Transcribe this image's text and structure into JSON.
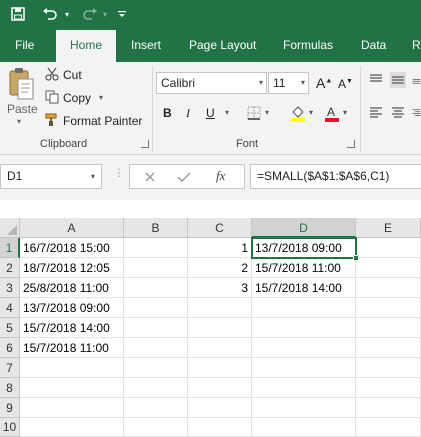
{
  "ribbon_tabs": [
    "File",
    "Home",
    "Insert",
    "Page Layout",
    "Formulas",
    "Data",
    "R"
  ],
  "active_tab": "Home",
  "clipboard": {
    "paste_label": "Paste",
    "cut_label": "Cut",
    "copy_label": "Copy",
    "format_painter_label": "Format Painter",
    "group_label": "Clipboard"
  },
  "font": {
    "font_name": "Calibri",
    "font_size": "11",
    "group_label": "Font"
  },
  "formula_bar": {
    "name_box": "D1",
    "fx_label": "fx",
    "formula": "=SMALL($A$1:$A$6,C1)"
  },
  "sheet": {
    "columns": [
      "A",
      "B",
      "C",
      "D",
      "E"
    ],
    "rows": [
      "1",
      "2",
      "3",
      "4",
      "5",
      "6",
      "7",
      "8",
      "9",
      "10"
    ],
    "col_a": [
      "16/7/2018 15:00",
      "18/7/2018 12:05",
      "25/8/2018 11:00",
      "13/7/2018 09:00",
      "15/7/2018 14:00",
      "15/7/2018 11:00"
    ],
    "col_c": [
      "1",
      "2",
      "3"
    ],
    "col_d": [
      "13/7/2018 09:00",
      "15/7/2018 11:00",
      "15/7/2018 14:00"
    ],
    "selected_cell": "D1"
  },
  "colors": {
    "accent": "#217346",
    "ribbon_bg": "#f3f3f3"
  }
}
